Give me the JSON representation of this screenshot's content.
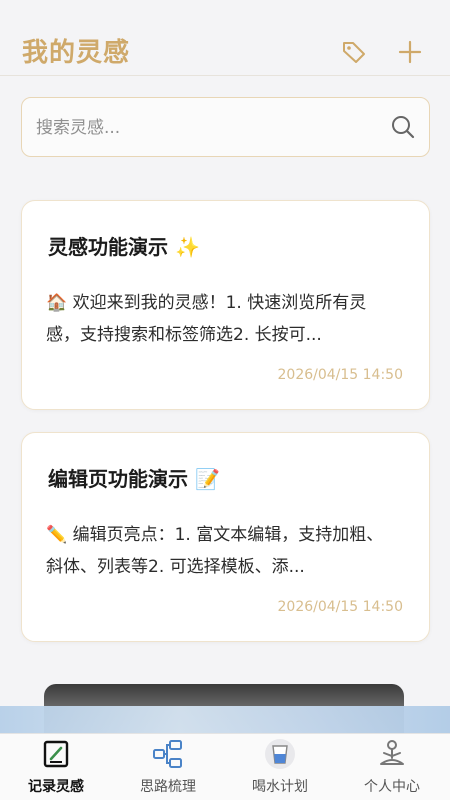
{
  "header": {
    "title": "我的灵感",
    "tag_icon": "tag-icon",
    "add_icon": "plus-icon",
    "accent_color": "#cfa96a"
  },
  "search": {
    "placeholder": "搜索灵感...",
    "icon": "search-icon"
  },
  "notes": [
    {
      "title": "灵感功能演示 ✨",
      "body": "🏠 欢迎来到我的灵感！1. 快速浏览所有灵感，支持搜索和标签筛选2. 长按可...",
      "time": "2026/04/15 14:50"
    },
    {
      "title": "编辑页功能演示 📝",
      "body": "✏️ 编辑页亮点：1. 富文本编辑，支持加粗、斜体、列表等2. 可选择模板、添...",
      "time": "2026/04/15 14:50"
    }
  ],
  "tabs": [
    {
      "label": "记录灵感",
      "icon": "edit-note-icon",
      "active": true
    },
    {
      "label": "思路梳理",
      "icon": "mindmap-icon",
      "active": false
    },
    {
      "label": "喝水计划",
      "icon": "water-cup-icon",
      "active": false
    },
    {
      "label": "个人中心",
      "icon": "meditation-person-icon",
      "active": false
    }
  ]
}
